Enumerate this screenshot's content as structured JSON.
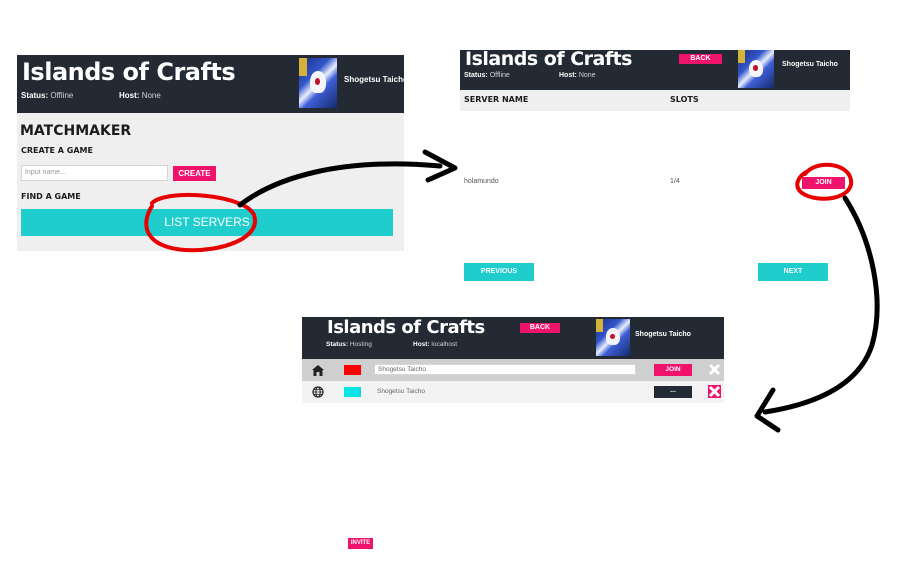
{
  "panel1": {
    "app_title": "Islands of Crafts",
    "status_label": "Status:",
    "status_value": "Offline",
    "host_label": "Host:",
    "host_value": "None",
    "username": "Shogetsu Taicho",
    "matchmaker_heading": "MATCHMAKER",
    "create_game_label": "CREATE A GAME",
    "name_input_placeholder": "Input name...",
    "create_button": "CREATE",
    "find_game_label": "FIND A GAME",
    "list_servers_button": "LIST SERVERS"
  },
  "panel2": {
    "app_title": "Islands of Crafts",
    "back_button": "BACK",
    "status_label": "Status:",
    "status_value": "Offline",
    "host_label": "Host:",
    "host_value": "None",
    "username": "Shogetsu Taicho",
    "columns": [
      "SERVER NAME",
      "SLOTS"
    ],
    "servers": [
      {
        "name": "holamundo",
        "slots": "1/4",
        "join_label": "JOIN"
      }
    ],
    "previous_button": "PREVIOUS",
    "next_button": "NEXT"
  },
  "panel3": {
    "app_title": "Islands of Crafts",
    "back_button": "BACK",
    "status_label": "Status:",
    "status_value": "Hosting",
    "host_label": "Host:",
    "host_value": "localhost",
    "username": "Shogetsu Taicho",
    "players": [
      {
        "icon": "home-icon",
        "color": "#ff0000",
        "name": "Shogetsu Taicho",
        "action_label": "JOIN"
      },
      {
        "icon": "globe-icon",
        "color": "#00e5e5",
        "name": "Shogetsu Taicho",
        "action_label": "..."
      }
    ]
  },
  "invite_button": "INVITE",
  "colors": {
    "header_bg": "#232a33",
    "accent_pink": "#f0136b",
    "accent_teal": "#1fcdcd",
    "annotation_red": "#e60000"
  }
}
